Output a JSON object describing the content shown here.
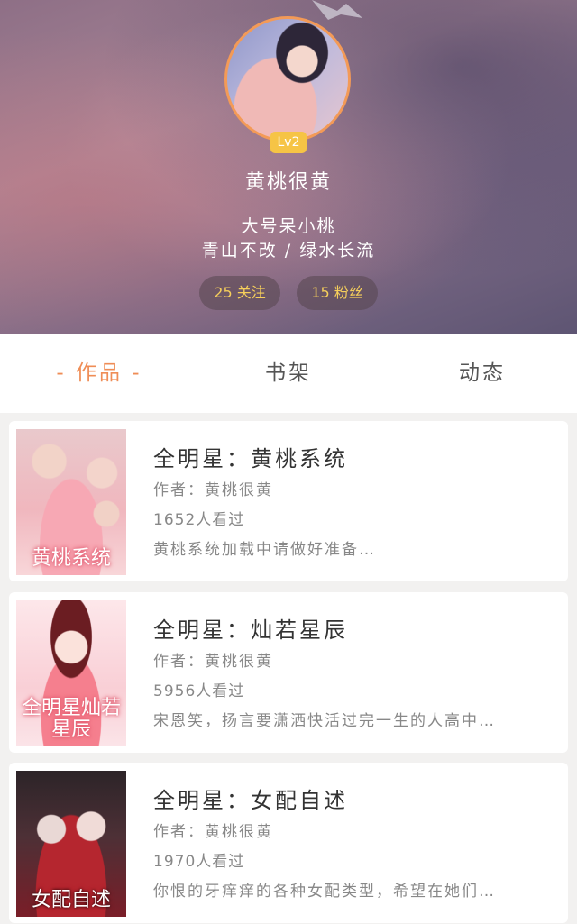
{
  "profile": {
    "level": "Lv2",
    "username": "黄桃很黄",
    "bio_line1": "大号呆小桃",
    "bio_line2": "青山不改 / 绿水长流",
    "following": "25 关注",
    "fans": "15 粉丝"
  },
  "tabs": [
    {
      "label": "- 作品 -",
      "active": true
    },
    {
      "label": "书架",
      "active": false
    },
    {
      "label": "动态",
      "active": false
    }
  ],
  "books": [
    {
      "title": "全明星：黄桃系统",
      "author": "作者：黄桃很黄",
      "views": "1652人看过",
      "description": "黄桃系统加载中请做好准备…",
      "cover_text": "黄桃系统"
    },
    {
      "title": "全明星：灿若星辰",
      "author": "作者：黄桃很黄",
      "views": "5956人看过",
      "description": "宋恩笑，扬言要潇洒快活过完一生的人高中…",
      "cover_text": "全明星灿若星辰"
    },
    {
      "title": "全明星：女配自述",
      "author": "作者：黄桃很黄",
      "views": "1970人看过",
      "description": "你恨的牙痒痒的各种女配类型，希望在她们…",
      "cover_text": "女配自述"
    }
  ],
  "colors": {
    "accent": "#ef8d56",
    "badge": "#f6c445",
    "stat_text": "#f6cf5b"
  }
}
